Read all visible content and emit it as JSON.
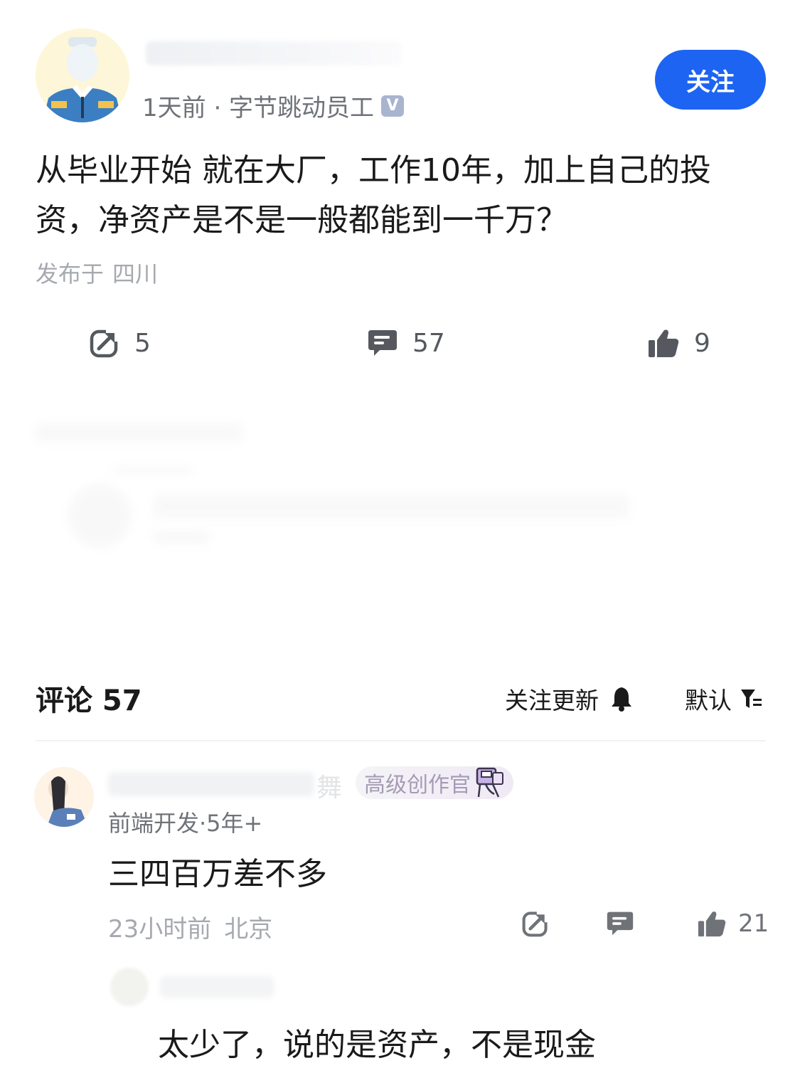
{
  "header": {
    "meta": "1天前 · 字节跳动员工",
    "verified_mark": "V",
    "follow_label": "关注"
  },
  "post": {
    "text": "从毕业开始 就在大厂，工作10年，加上自己的投资，净资产是不是一般都能到一千万？",
    "published_prefix": "发布于",
    "published_location": "四川"
  },
  "stats": {
    "repost_count": "5",
    "comment_count": "57",
    "like_count": "9"
  },
  "comments_section": {
    "title": "评论 57",
    "follow_updates_label": "关注更新",
    "sort_label": "默认"
  },
  "comment": {
    "name_tail": "舞",
    "badge": "高级创作官",
    "meta": "前端开发·5年+",
    "text": "三四百万差不多",
    "time": "23小时前",
    "location": "北京",
    "like_count": "21"
  },
  "reply": {
    "text": "太少了，说的是资产，不是现金"
  },
  "colors": {
    "accent": "#1d64f2",
    "text_primary": "#1a1a1a",
    "text_secondary": "#6f7378",
    "text_muted": "#a6a9ae"
  }
}
